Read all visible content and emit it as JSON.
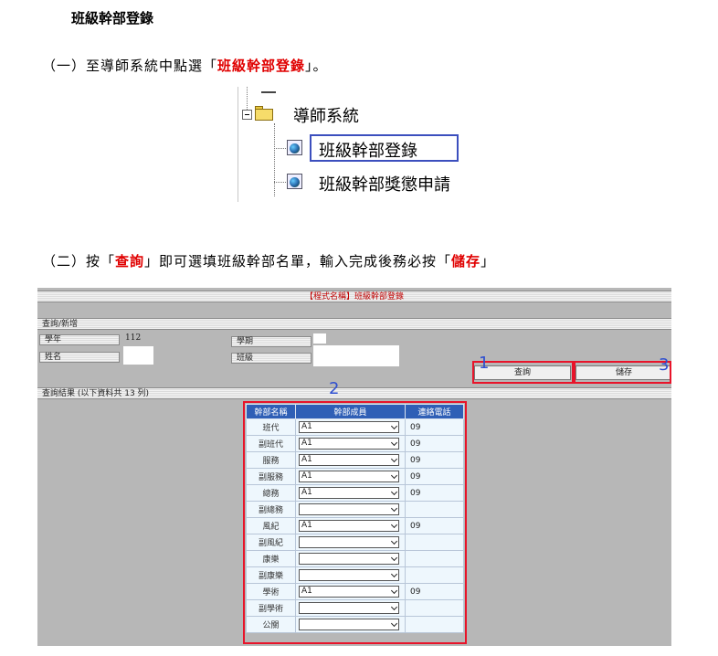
{
  "doc": {
    "heading": "班級幹部登錄",
    "step1": {
      "prefix": "（一）至導師系統中點選「",
      "highlight": "班級幹部登錄",
      "suffix": "」。"
    },
    "step2": {
      "prefix": "（二）按「",
      "highlight1": "查詢",
      "middle": "」即可選填班級幹部名單，輸入完成後務必按「",
      "highlight2": "儲存",
      "suffix": "」"
    }
  },
  "tree": {
    "folder_label": "導師系統",
    "items": [
      "班級幹部登錄",
      "班級幹部獎懲申請"
    ]
  },
  "form": {
    "title": "【程式名稱】班級幹部登錄",
    "section_query": "查詢/新增",
    "fields": {
      "year_label": "學年",
      "year_value": "112",
      "term_label": "學期",
      "name_label": "姓名",
      "class_label": "班級"
    },
    "buttons": {
      "query": "查詢",
      "save": "儲存"
    },
    "results_label": "查詢結果 (以下資料共 13 列)",
    "markers": [
      "1",
      "2",
      "3"
    ],
    "table": {
      "headers": [
        "幹部名稱",
        "幹部成員",
        "連絡電話"
      ],
      "rows": [
        {
          "position": "班代",
          "member": "A1",
          "phone": "09"
        },
        {
          "position": "副班代",
          "member": "A1",
          "phone": "09"
        },
        {
          "position": "服務",
          "member": "A1",
          "phone": "09"
        },
        {
          "position": "副服務",
          "member": "A1",
          "phone": "09"
        },
        {
          "position": "總務",
          "member": "A1",
          "phone": "09"
        },
        {
          "position": "副總務",
          "member": "",
          "phone": ""
        },
        {
          "position": "風紀",
          "member": "A1",
          "phone": "09"
        },
        {
          "position": "副風紀",
          "member": "",
          "phone": ""
        },
        {
          "position": "康樂",
          "member": "",
          "phone": ""
        },
        {
          "position": "副康樂",
          "member": "",
          "phone": ""
        },
        {
          "position": "學術",
          "member": "A1",
          "phone": "09"
        },
        {
          "position": "副學術",
          "member": "",
          "phone": ""
        },
        {
          "position": "公關",
          "member": "",
          "phone": ""
        }
      ]
    }
  },
  "colors": {
    "highlight_red": "#e00000",
    "box_red": "#e8142a",
    "tree_box_blue": "#3c4fbe",
    "table_header_blue": "#2f5fb6",
    "marker_blue": "#2f4fcf"
  }
}
